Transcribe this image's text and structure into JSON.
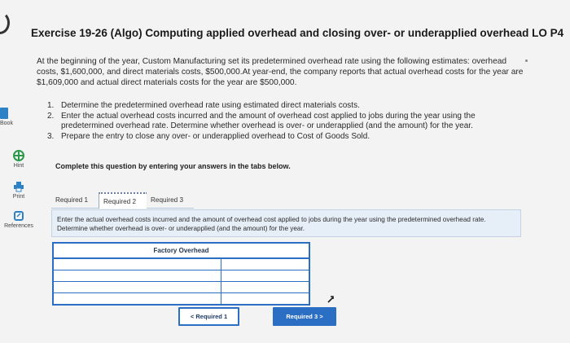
{
  "sidebar": {
    "book_label": "Book",
    "hint_label": "Hint",
    "print_label": "Print",
    "references_label": "References",
    "icons": [
      "book-icon",
      "hint-icon",
      "print-icon",
      "references-icon"
    ]
  },
  "title": "Exercise 19-26 (Algo) Computing applied overhead and closing over- or underapplied overhead LO P4",
  "intro": "At the beginning of the year, Custom Manufacturing set its predetermined overhead rate using the following estimates: overhead costs, $1,600,000, and direct materials costs, $500,000.At year-end, the company reports that actual overhead costs for the year are $1,609,000 and actual direct materials costs for the year are $500,000.",
  "requirements": [
    {
      "num": "1.",
      "text": "Determine the predetermined overhead rate using estimated direct materials costs."
    },
    {
      "num": "2.",
      "text": "Enter the actual overhead costs incurred and the amount of overhead cost applied to jobs during the year using the predetermined overhead rate. Determine whether overhead is over- or underapplied (and the amount) for the year."
    },
    {
      "num": "3.",
      "text": "Prepare the entry to close any over- or underapplied overhead to Cost of Goods Sold."
    }
  ],
  "instruction": "Complete this question by entering your answers in the tabs below.",
  "tabs": [
    "Required 1",
    "Required 2",
    "Required 3"
  ],
  "active_tab": "Required 2",
  "panel_text": "Enter the actual overhead costs incurred and the amount of overhead cost applied to jobs during the year using the predetermined overhead rate. Determine whether overhead is over- or underapplied (and the amount) for the year.",
  "table": {
    "header": "Factory Overhead",
    "rows": [
      [
        "",
        ""
      ],
      [
        "",
        ""
      ],
      [
        "",
        ""
      ],
      [
        "",
        ""
      ]
    ]
  },
  "nav": {
    "prev_label": "Required 1",
    "next_label": "Required 3",
    "prev_glyph": "<",
    "next_glyph": ">"
  },
  "colors": {
    "accent": "#2b6fc4",
    "panel_bg": "#e6eef7",
    "hint_green": "#2a9a4a",
    "print_blue": "#2d82c6"
  }
}
